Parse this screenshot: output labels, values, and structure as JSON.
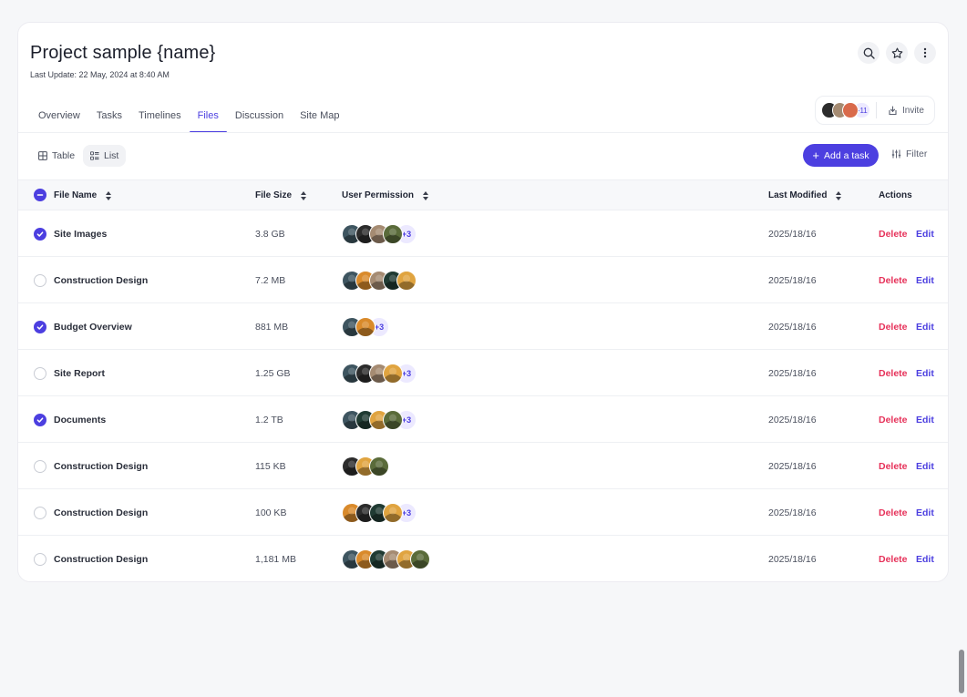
{
  "header": {
    "title": "Project sample {name}",
    "subtitle": "Last Update: 22 May, 2024 at 8:40 AM",
    "collaborators_more": "+11",
    "invite_label": "Invite"
  },
  "tabs": [
    {
      "label": "Overview"
    },
    {
      "label": "Tasks"
    },
    {
      "label": "Timelines"
    },
    {
      "label": "Files",
      "active": true
    },
    {
      "label": "Discussion"
    },
    {
      "label": "Site Map"
    }
  ],
  "toolbar": {
    "view_table": "Table",
    "view_list": "List",
    "add_task": "Add a task",
    "filter": "Filter"
  },
  "table": {
    "headers": {
      "name": "File Name",
      "size": "File Size",
      "permission": "User Permission",
      "modified": "Last Modified",
      "actions": "Actions"
    },
    "delete_label": "Delete",
    "edit_label": "Edit",
    "rows": [
      {
        "name": "Site Images",
        "size": "3.8 GB",
        "modified": "2025/18/16",
        "checked": true,
        "avatars": [
          "#3e5560",
          "#2c2c2c",
          "#a58b72",
          "#5a6b3a"
        ],
        "more": "+3"
      },
      {
        "name": "Construction Design",
        "size": "7.2 MB",
        "modified": "2025/18/16",
        "checked": false,
        "avatars": [
          "#3e5560",
          "#d98a2b",
          "#a58b72",
          "#203b33",
          "#e0a440"
        ],
        "more": ""
      },
      {
        "name": "Budget Overview",
        "size": "881 MB",
        "modified": "2025/18/16",
        "checked": true,
        "avatars": [
          "#3e5560",
          "#d98a2b"
        ],
        "more": "+3"
      },
      {
        "name": "Site Report",
        "size": "1.25 GB",
        "modified": "2025/18/16",
        "checked": false,
        "avatars": [
          "#3e5560",
          "#2c2c2c",
          "#a58b72",
          "#e0a440"
        ],
        "more": "+3"
      },
      {
        "name": "Documents",
        "size": "1.2 TB",
        "modified": "2025/18/16",
        "checked": true,
        "avatars": [
          "#3e5560",
          "#203b33",
          "#e0a440",
          "#5a6b3a"
        ],
        "more": "+3"
      },
      {
        "name": "Construction Design",
        "size": "115 KB",
        "modified": "2025/18/16",
        "checked": false,
        "avatars": [
          "#2c2c2c",
          "#e0a440",
          "#5a6b3a"
        ],
        "more": ""
      },
      {
        "name": "Construction Design",
        "size": "100 KB",
        "modified": "2025/18/16",
        "checked": false,
        "avatars": [
          "#d98a2b",
          "#2c2c2c",
          "#203b33",
          "#e0a440"
        ],
        "more": "+3"
      },
      {
        "name": "Construction Design",
        "size": "1,181 MB",
        "modified": "2025/18/16",
        "checked": false,
        "avatars": [
          "#3e5560",
          "#d98a2b",
          "#203b33",
          "#a58b72",
          "#e0a440",
          "#5a6b3a"
        ],
        "more": ""
      }
    ]
  },
  "colors": {
    "accent": "#4c3fe0",
    "danger": "#e6325a",
    "background": "#f6f7f9"
  },
  "icons": [
    "search-icon",
    "star-icon",
    "more-vertical-icon",
    "invite-icon",
    "table-icon",
    "list-icon",
    "plus-icon",
    "filter-icon",
    "sort-icon",
    "check-icon",
    "minus-icon"
  ]
}
